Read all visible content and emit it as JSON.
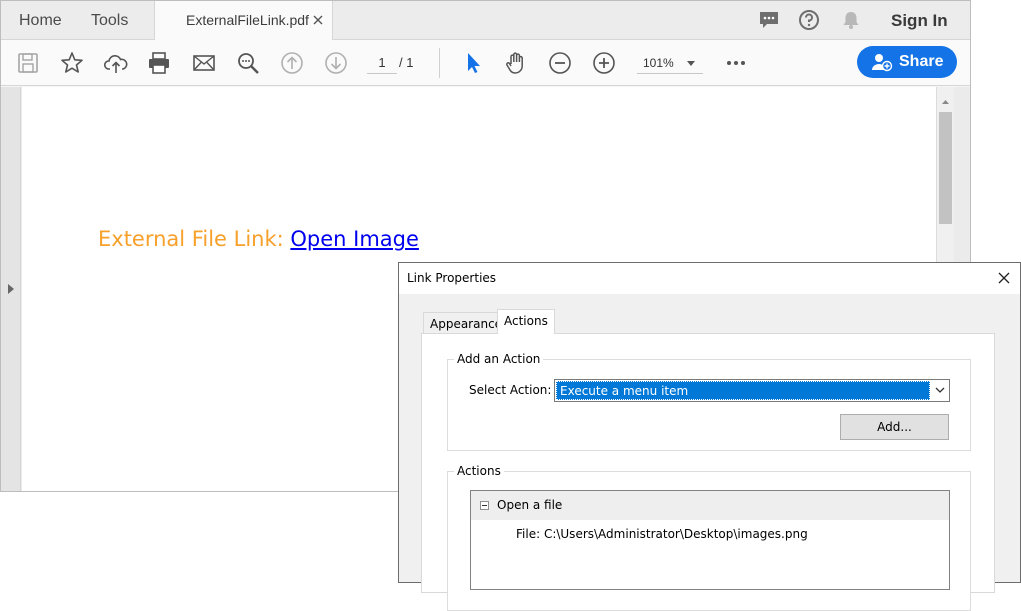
{
  "menu": {
    "home": "Home",
    "tools": "Tools",
    "document_tab": "ExternalFileLink.pdf",
    "sign_in": "Sign In"
  },
  "toolbar": {
    "current_page": "1",
    "page_total": "/ 1",
    "zoom": "101%",
    "share_label": "Share",
    "accent_color": "#1473e6"
  },
  "document": {
    "label": "External File Link: ",
    "link_text": "Open Image",
    "label_color": "#f7a02a",
    "link_color": "#0000ee"
  },
  "dialog": {
    "title": "Link Properties",
    "tabs": [
      "Appearance",
      "Actions"
    ],
    "active_tab": "Actions",
    "add_action_group": "Add an Action",
    "select_action_label": "Select Action:",
    "selected_action": "Execute a menu item",
    "add_button": "Add...",
    "actions_group": "Actions",
    "actions": [
      {
        "name": "Open a file",
        "detail": "File: C:\\Users\\Administrator\\Desktop\\images.png"
      }
    ]
  },
  "icons": {
    "save": "save-icon",
    "bookmark": "star-icon",
    "upload": "cloud-upload-icon",
    "print": "printer-icon",
    "email": "mail-icon",
    "find": "search-zoom-icon",
    "prev": "arrow-up-circle-icon",
    "next": "arrow-down-circle-icon",
    "select": "cursor-arrow-icon",
    "hand": "hand-icon",
    "zoom_out": "zoom-out-icon",
    "zoom_in": "zoom-in-icon",
    "more": "more-dots-icon",
    "comment": "comment-icon",
    "help": "help-icon",
    "notifications": "bell-icon"
  }
}
